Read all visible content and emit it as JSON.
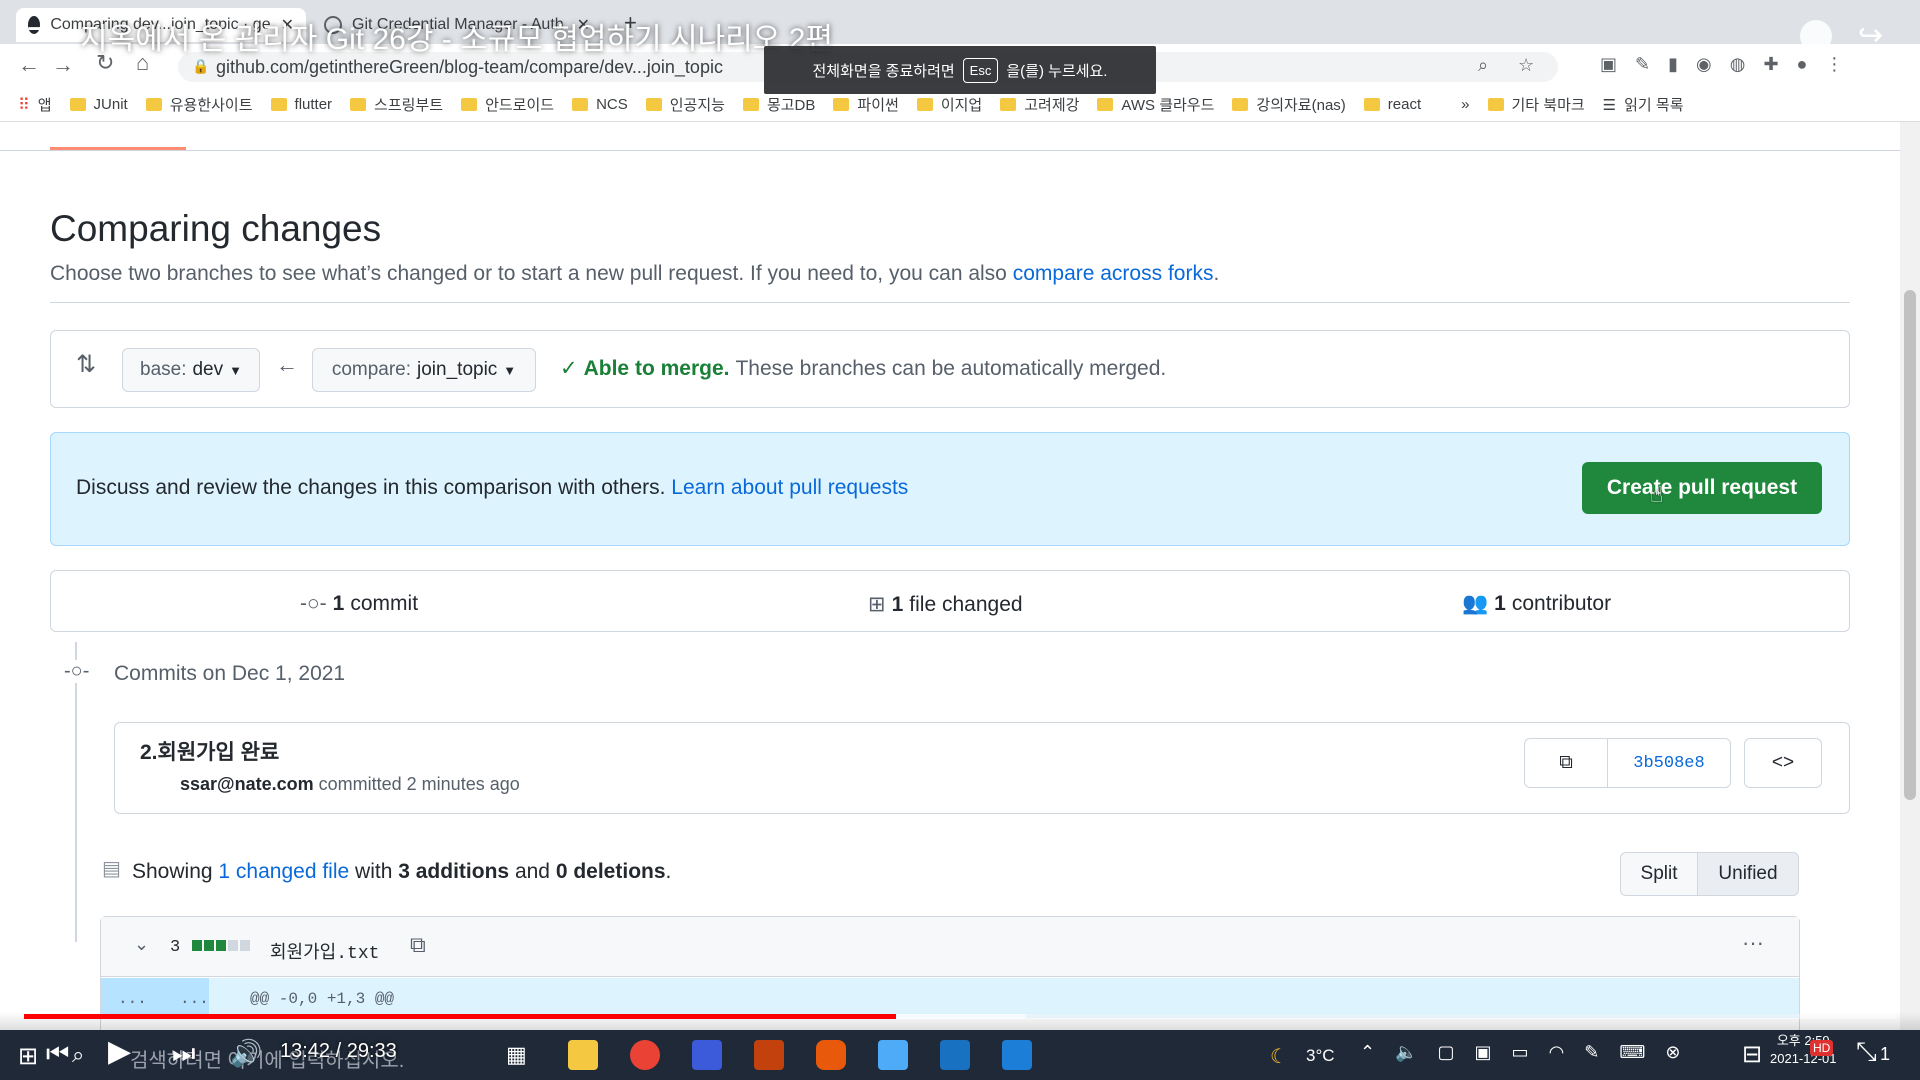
{
  "browser": {
    "tabs": [
      {
        "title": "Comparing dev...join_topic · ge",
        "active": true
      },
      {
        "title": "Git Credential Manager - Auth",
        "active": false
      }
    ],
    "new_tab": "+",
    "address": "github.com/getinthereGreen/blog-team/compare/dev...join_topic",
    "bookmarks": [
      "앱",
      "JUnit",
      "유용한사이트",
      "flutter",
      "스프링부트",
      "안드로이드",
      "NCS",
      "인공지능",
      "몽고DB",
      "파이썬",
      "이지업",
      "고려제강",
      "AWS 클라우드",
      "강의자료(nas)",
      "react"
    ],
    "bookmarks_overflow": "»",
    "other_bookmarks": "기타 북마크",
    "reading_list": "읽기 목록"
  },
  "overlay": {
    "video_title": "지옥에서 온 관리자 Git 26강 - 소규모 협업하기 시나리오 2편",
    "esc_before": "전체화면을 종료하려면",
    "esc_key": "Esc",
    "esc_after": "을(를) 누르세요."
  },
  "github": {
    "title": "Comparing changes",
    "subtitle_text": "Choose two branches to see what’s changed or to start a new pull request. If you need to, you can also",
    "subtitle_link": "compare across forks",
    "subtitle_end": ".",
    "base_label": "base:",
    "base_value": "dev",
    "compare_label": "compare:",
    "compare_value": "join_topic",
    "merge_status": "Able to merge.",
    "merge_detail": "These branches can be automatically merged.",
    "discuss_text": "Discuss and review the changes in this comparison with others.",
    "discuss_link": "Learn about pull requests",
    "create_pr": "Create pull request",
    "stats": {
      "commits_count": "1",
      "commits_label": "commit",
      "files_count": "1",
      "files_label": "file changed",
      "contributors_count": "1",
      "contributors_label": "contributor"
    },
    "commits_header": "Commits on Dec 1, 2021",
    "commit": {
      "message": "2.회원가입 완료",
      "author": "ssar@nate.com",
      "meta": "committed 2 minutes ago",
      "sha": "3b508e8"
    },
    "summary": {
      "prefix": "Showing",
      "files_link": "1 changed file",
      "with": "with",
      "additions": "3 additions",
      "and": "and",
      "deletions": "0 deletions",
      "end": "."
    },
    "split_label": "Split",
    "unified_label": "Unified",
    "file": {
      "change_count": "3",
      "name": "회원가입.txt",
      "hunk_left": "...",
      "hunk_right": "...",
      "hunk_header": "@@ -0,0 +1,3 @@"
    }
  },
  "video": {
    "time": "13:42 / 29:33",
    "progress_fraction": 0.466,
    "buffer_fraction": 0.535,
    "caption": "검색하려면 여기에 입력하십시오."
  },
  "taskbar": {
    "weather": "3°C",
    "time": "오후 2:59",
    "date": "2021-12-01",
    "notif": "1"
  }
}
